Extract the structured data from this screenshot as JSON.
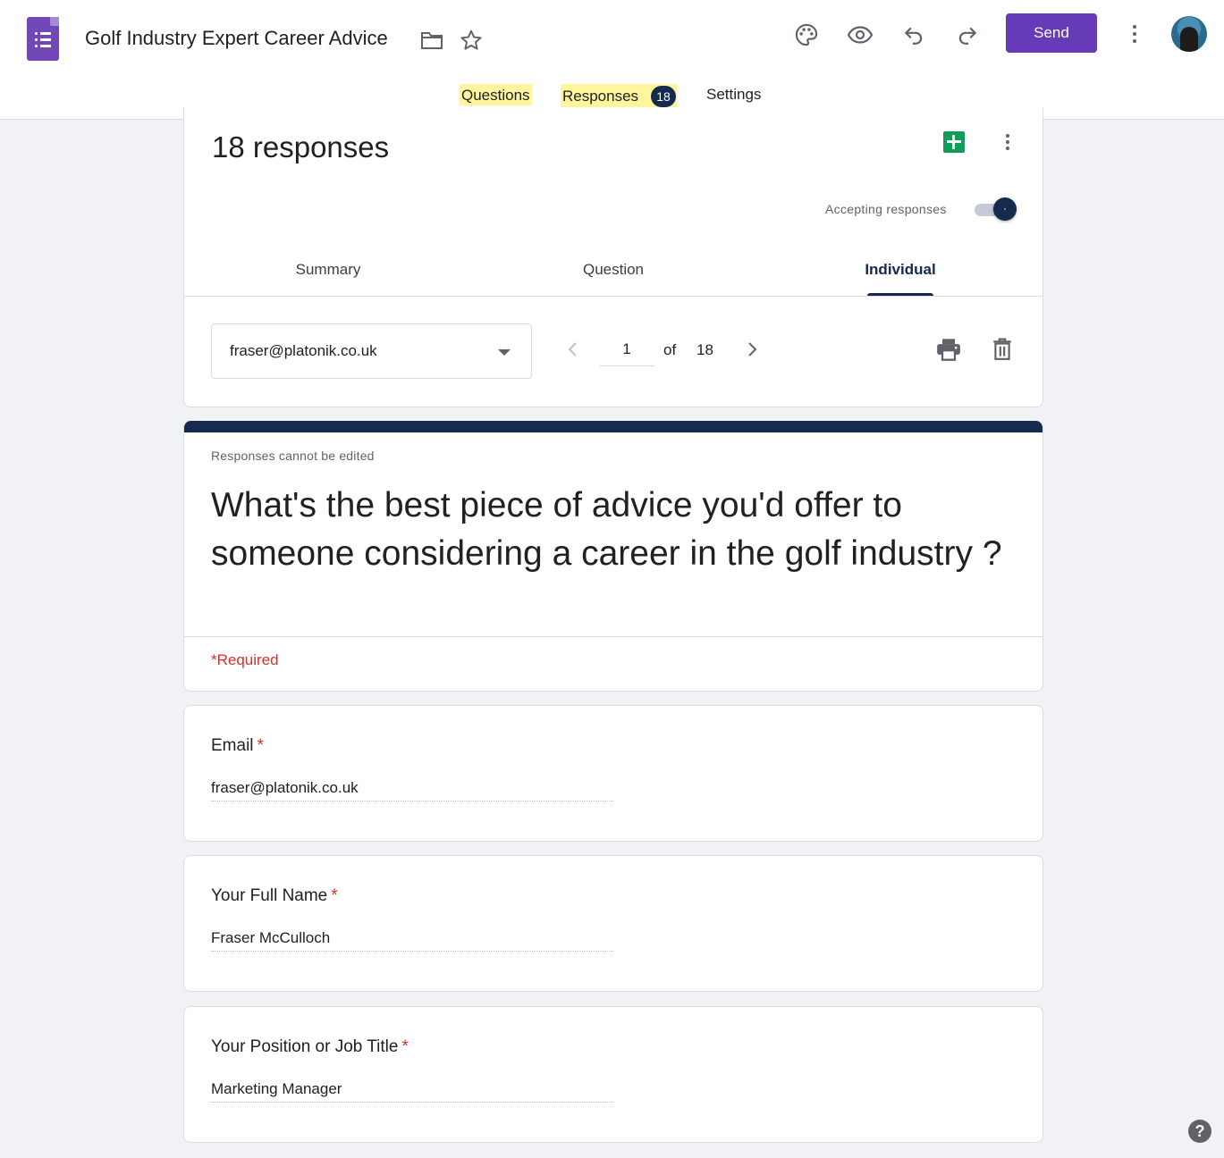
{
  "app": {
    "title": "Golf Industry Expert Career Advice",
    "send_label": "Send",
    "accent_color": "#673ab7",
    "theme_color": "#152a4f"
  },
  "nav": {
    "tabs": [
      {
        "label": "Questions"
      },
      {
        "label": "Responses",
        "badge": "18"
      },
      {
        "label": "Settings"
      }
    ],
    "active": "Responses"
  },
  "summary": {
    "title": "18 responses",
    "accepting_label": "Accepting responses",
    "accepting": true,
    "sub_tabs": [
      "Summary",
      "Question",
      "Individual"
    ],
    "active_sub_tab": "Individual"
  },
  "individual": {
    "selected_email": "fraser@platonik.co.uk",
    "current_page": "1",
    "of_label": "of",
    "total": "18"
  },
  "form": {
    "notice": "Responses cannot be edited",
    "title": "What's the best piece of advice you'd offer to someone considering a career in the golf industry ?",
    "required_note": "*Required"
  },
  "questions": [
    {
      "label": "Email",
      "required_mark": "*",
      "answer": "fraser@platonik.co.uk"
    },
    {
      "label": "Your Full Name",
      "required_mark": "*",
      "answer": "Fraser McCulloch"
    },
    {
      "label": "Your Position or Job Title",
      "required_mark": "*",
      "answer": "Marketing Manager"
    }
  ],
  "help": {
    "label": "?"
  }
}
